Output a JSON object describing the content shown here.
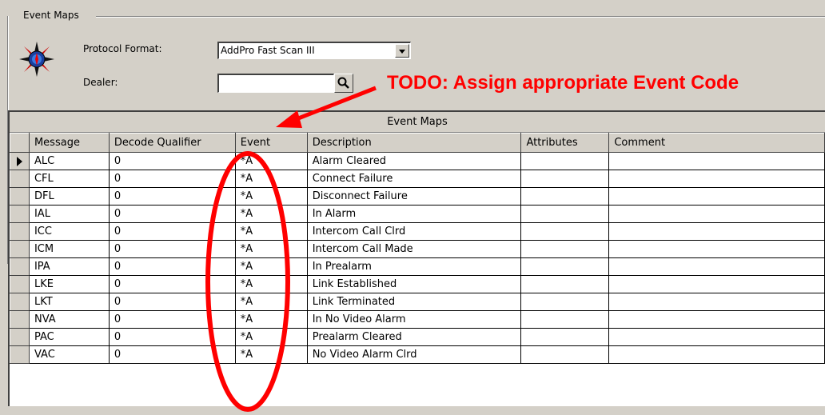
{
  "group": {
    "label": "Event Maps"
  },
  "form": {
    "protocol_label": "Protocol Format:",
    "protocol_value": "AddPro Fast Scan III",
    "dealer_label": "Dealer:",
    "dealer_value": ""
  },
  "grid": {
    "caption": "Event Maps",
    "columns": [
      "Message",
      "Decode Qualifier",
      "Event",
      "Description",
      "Attributes",
      "Comment"
    ],
    "rows": [
      {
        "message": "ALC",
        "qualifier": "0",
        "event": "*A",
        "description": "Alarm Cleared",
        "attributes": "",
        "comment": ""
      },
      {
        "message": "CFL",
        "qualifier": "0",
        "event": "*A",
        "description": "Connect Failure",
        "attributes": "",
        "comment": ""
      },
      {
        "message": "DFL",
        "qualifier": "0",
        "event": "*A",
        "description": "Disconnect Failure",
        "attributes": "",
        "comment": ""
      },
      {
        "message": "IAL",
        "qualifier": "0",
        "event": "*A",
        "description": "In Alarm",
        "attributes": "",
        "comment": ""
      },
      {
        "message": "ICC",
        "qualifier": "0",
        "event": "*A",
        "description": "Intercom Call Clrd",
        "attributes": "",
        "comment": ""
      },
      {
        "message": "ICM",
        "qualifier": "0",
        "event": "*A",
        "description": "Intercom Call Made",
        "attributes": "",
        "comment": ""
      },
      {
        "message": "IPA",
        "qualifier": "0",
        "event": "*A",
        "description": "In Prealarm",
        "attributes": "",
        "comment": ""
      },
      {
        "message": "LKE",
        "qualifier": "0",
        "event": "*A",
        "description": "Link Established",
        "attributes": "",
        "comment": ""
      },
      {
        "message": "LKT",
        "qualifier": "0",
        "event": "*A",
        "description": "Link Terminated",
        "attributes": "",
        "comment": ""
      },
      {
        "message": "NVA",
        "qualifier": "0",
        "event": "*A",
        "description": "In No Video Alarm",
        "attributes": "",
        "comment": ""
      },
      {
        "message": "PAC",
        "qualifier": "0",
        "event": "*A",
        "description": "Prealarm Cleared",
        "attributes": "",
        "comment": ""
      },
      {
        "message": "VAC",
        "qualifier": "0",
        "event": "*A",
        "description": "No Video Alarm Clrd",
        "attributes": "",
        "comment": ""
      }
    ]
  },
  "annotation": {
    "text": "TODO:  Assign appropriate Event Code",
    "color": "#ff0000"
  },
  "icons": {
    "logo": "compass-logo-icon",
    "dropdown": "chevron-down-icon",
    "search": "magnifier-icon",
    "row_pointer": "row-pointer-icon"
  }
}
